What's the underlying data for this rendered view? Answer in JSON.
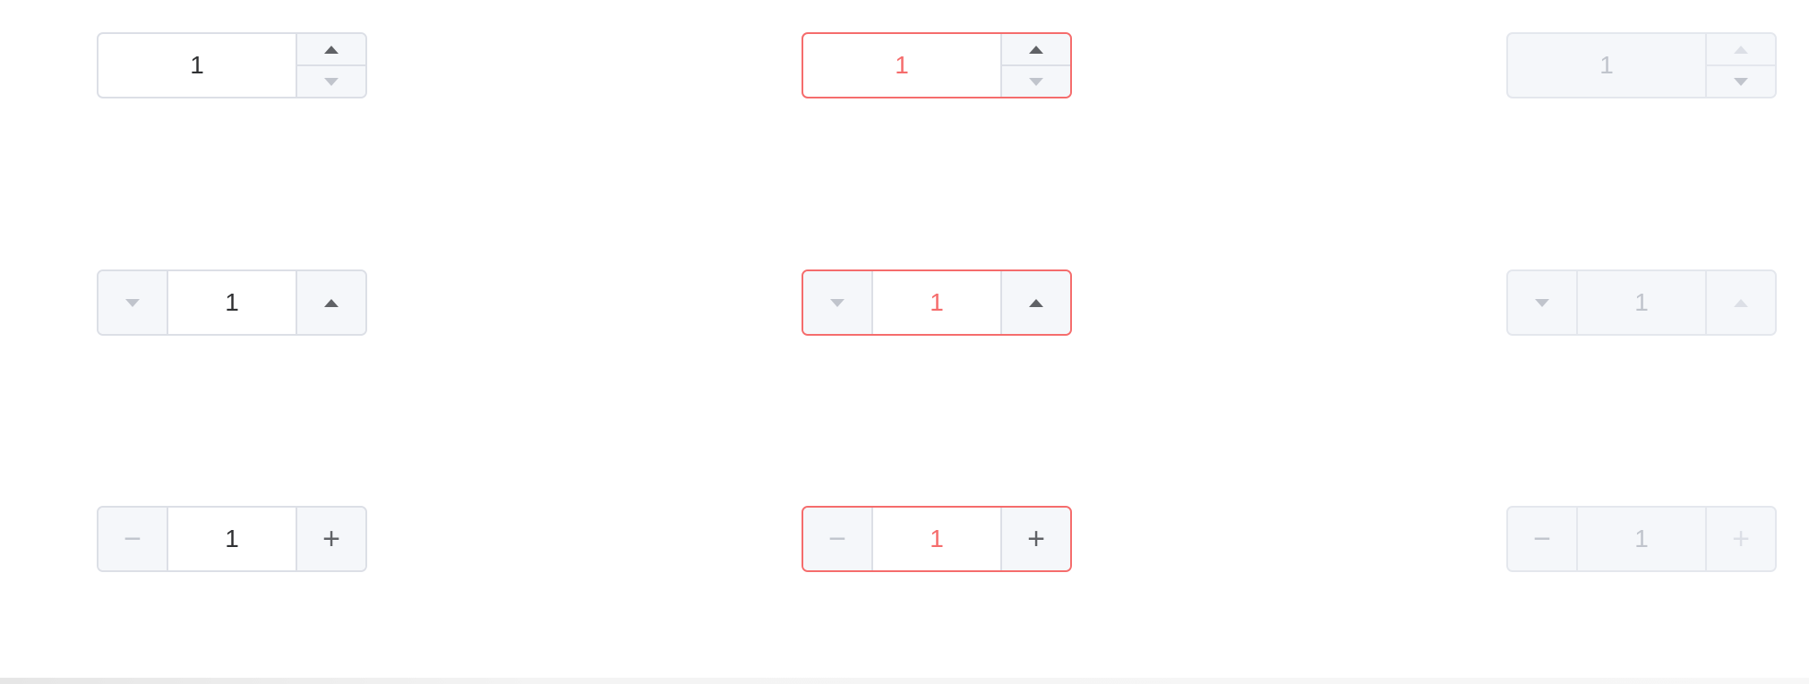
{
  "value": "1",
  "colors": {
    "border": "#dcdfe6",
    "error": "#f56c6c",
    "control_bg": "#f5f7fa",
    "text": "#303133",
    "disabled_text": "#c0c4cc"
  },
  "icons": {
    "up": "triangle-up",
    "down": "triangle-down",
    "minus": "minus",
    "plus": "plus"
  },
  "glyphs": {
    "minus": "−",
    "plus": "+"
  }
}
